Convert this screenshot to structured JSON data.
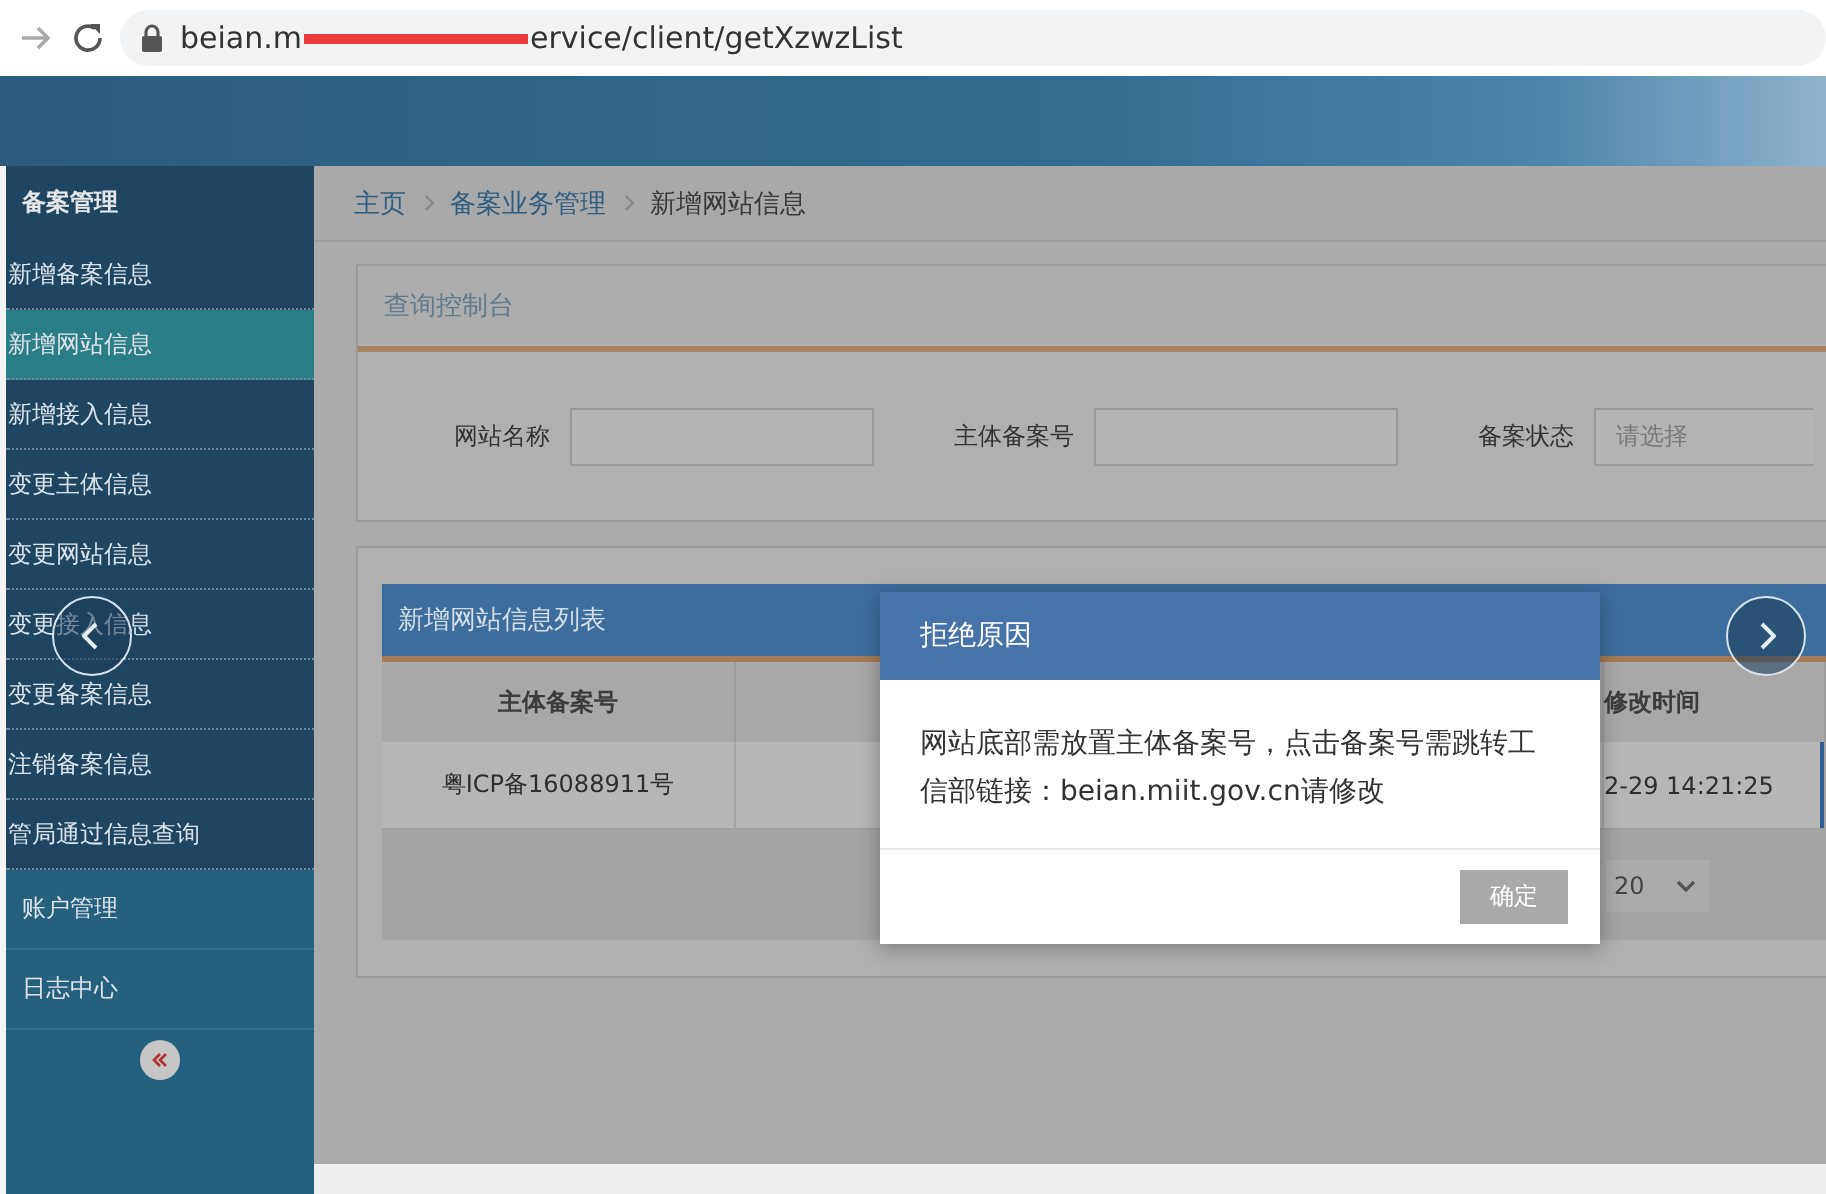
{
  "browser": {
    "url_start": "beian.m",
    "url_end": "ervice/client/getXzwzList"
  },
  "sidebar": {
    "title": "备案管理",
    "items": [
      {
        "label": "新增备案信息",
        "selected": false
      },
      {
        "label": "新增网站信息",
        "selected": true
      },
      {
        "label": "新增接入信息",
        "selected": false
      },
      {
        "label": "变更主体信息",
        "selected": false
      },
      {
        "label": "变更网站信息",
        "selected": false
      },
      {
        "label": "变更接入信息",
        "selected": false
      },
      {
        "label": "变更备案信息",
        "selected": false
      },
      {
        "label": "注销备案信息",
        "selected": false
      },
      {
        "label": "管局通过信息查询",
        "selected": false
      }
    ],
    "sections": [
      {
        "label": "账户管理"
      },
      {
        "label": "日志中心"
      }
    ]
  },
  "breadcrumb": [
    "主页",
    "备案业务管理",
    "新增网站信息"
  ],
  "query_panel": {
    "title": "查询控制台",
    "fields": [
      {
        "label": "网站名称",
        "kind": "input"
      },
      {
        "label": "主体备案号",
        "kind": "input"
      },
      {
        "label": "备案状态",
        "kind": "select",
        "placeholder": "请选择"
      }
    ]
  },
  "list_panel": {
    "title": "新增网站信息列表",
    "columns": [
      "主体备案号",
      "修改时间"
    ],
    "rows": [
      [
        "粤ICP备16088911号",
        "2-29 14:21:25"
      ]
    ],
    "page_size": "20"
  },
  "dialog": {
    "title": "拒绝原因",
    "message": "网站底部需放置主体备案号，点击备案号需跳转工信部链接：beian.miit.gov.cn请修改",
    "button": "确定"
  }
}
